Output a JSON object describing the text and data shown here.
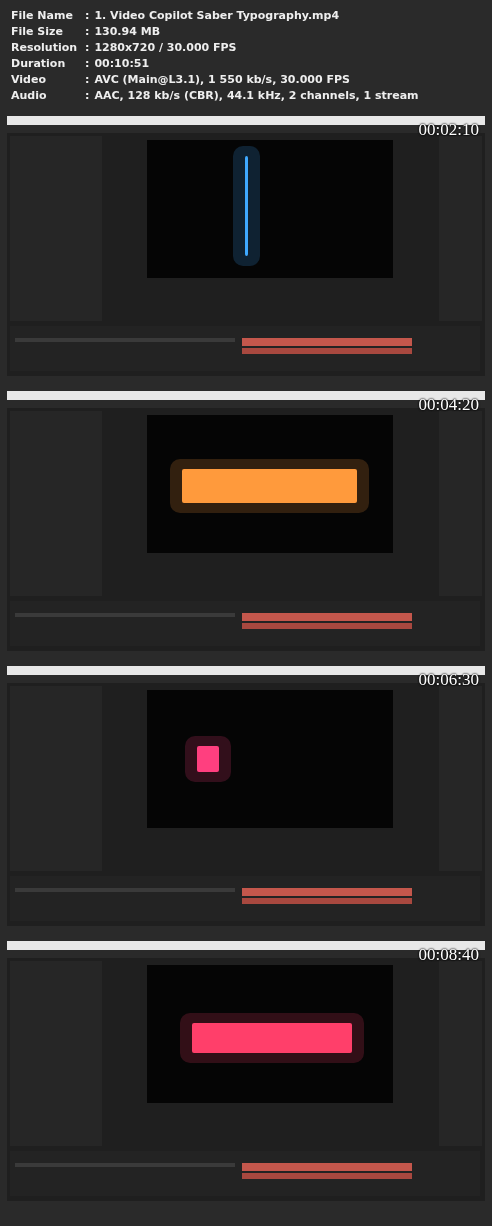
{
  "file_info": [
    {
      "label": "File Name",
      "separator": ":",
      "value": "1. Video Copilot Saber Typography.mp4"
    },
    {
      "label": "File Size",
      "separator": ":",
      "value": "130.94 MB"
    },
    {
      "label": "Resolution",
      "separator": ":",
      "value": "1280x720 / 30.000 FPS"
    },
    {
      "label": "Duration",
      "separator": ":",
      "value": "00:10:51"
    },
    {
      "label": "Video",
      "separator": ":",
      "value": "AVC (Main@L3.1), 1 550 kb/s, 30.000 FPS"
    },
    {
      "label": "Audio",
      "separator": ":",
      "value": "AAC, 128 kb/s (CBR), 44.1 kHz, 2 channels, 1 stream"
    }
  ],
  "frames": [
    {
      "timestamp": "00:02:10"
    },
    {
      "timestamp": "00:04:20"
    },
    {
      "timestamp": "00:06:30"
    },
    {
      "timestamp": "00:08:40"
    }
  ]
}
